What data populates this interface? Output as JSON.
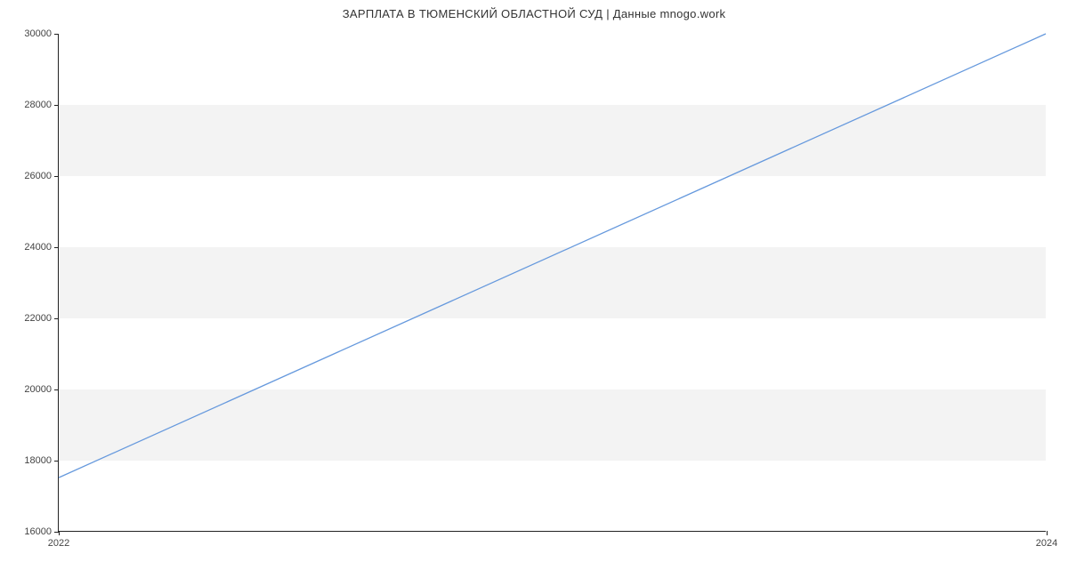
{
  "chart_data": {
    "type": "line",
    "title": "ЗАРПЛАТА В ТЮМЕНСКИЙ ОБЛАСТНОЙ СУД | Данные mnogo.work",
    "xlabel": "",
    "ylabel": "",
    "x": [
      2022,
      2024
    ],
    "values": [
      17500,
      30000
    ],
    "xlim": [
      2022,
      2024
    ],
    "ylim": [
      16000,
      30000
    ],
    "x_ticks": [
      2022,
      2024
    ],
    "y_ticks": [
      16000,
      18000,
      20000,
      22000,
      24000,
      26000,
      28000,
      30000
    ],
    "line_color": "#6699dd",
    "grid_bands": true
  }
}
